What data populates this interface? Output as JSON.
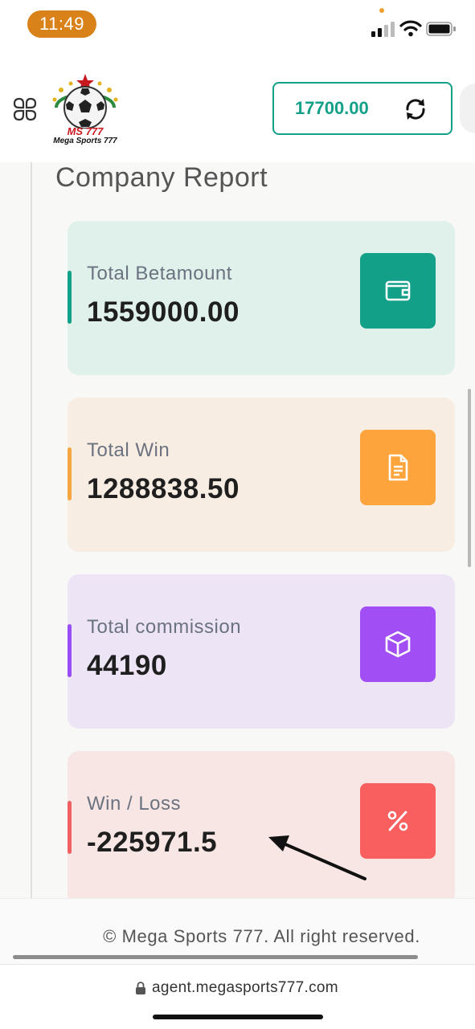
{
  "status_bar": {
    "time": "11:49"
  },
  "header": {
    "logo": {
      "line1": "MS 777",
      "line2": "Mega Sports 777"
    },
    "balance": "17700.00"
  },
  "page": {
    "title": "Company Report"
  },
  "cards": [
    {
      "label": "Total Betamount",
      "value": "1559000.00",
      "bg": "#e0f0ea",
      "accent": "#13a089",
      "icon_bg": "#13a089",
      "icon": "wallet-icon"
    },
    {
      "label": "Total Win",
      "value": "1288838.50",
      "bg": "#f8ede3",
      "accent": "#f5a640",
      "icon_bg": "#fda43c",
      "icon": "document-icon"
    },
    {
      "label": "Total commission",
      "value": "44190",
      "bg": "#ede5f6",
      "accent": "#9a4cf6",
      "icon_bg": "#a14ef5",
      "icon": "cube-icon"
    },
    {
      "label": "Win / Loss",
      "value": "-225971.5",
      "bg": "#f8e6e4",
      "accent": "#f06262",
      "icon_bg": "#f95f5f",
      "icon": "percent-icon"
    }
  ],
  "footer": {
    "copyright": "© Mega Sports 777. All right reserved."
  },
  "browser": {
    "url": "agent.megasports777.com"
  }
}
